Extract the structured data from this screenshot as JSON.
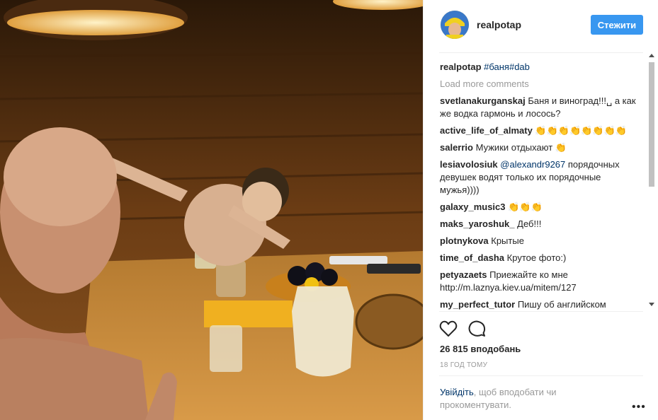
{
  "post": {
    "username": "realpotap",
    "follow_label": "Стежити",
    "caption_user": "realpotap",
    "caption_tags": "#баня#dab",
    "load_more": "Load more comments",
    "likes": "26 815 вподобань",
    "time": "18 ГОД ТОМУ",
    "login_link": "Увійдіть",
    "login_text": ", щоб вподобати чи прокоментувати.",
    "more": "•••"
  },
  "comments": [
    {
      "user": "svetlanakurganskaj",
      "text": "Баня и виноград!!!␣ а как же водка гармонь и лосось?"
    },
    {
      "user": "active_life_of_almaty",
      "text": "👏👏👏👏👏👏👏👏"
    },
    {
      "user": "salerrio",
      "text": "Мужики отдыхают 👏"
    },
    {
      "user": "lesiavolosiuk",
      "mention": "@alexandr9267",
      "text": " порядочных девушек водят только их порядочные мужья))))"
    },
    {
      "user": "galaxy_music3",
      "text": "👏👏👏"
    },
    {
      "user": "maks_yaroshuk_",
      "text": "Деб!!!"
    },
    {
      "user": "plotnykova",
      "text": "Крытые"
    },
    {
      "user": "time_of_dasha",
      "text": "Крутое фото:)"
    },
    {
      "user": "petyazaets",
      "text": "Приежайте ко мне http://m.laznya.kiev.ua/mitem/127"
    },
    {
      "user": "my_perfect_tutor",
      "text": "Пишу об английском"
    }
  ],
  "icons": {
    "heart": "heart-icon",
    "comment": "comment-icon",
    "more": "more-options-icon"
  },
  "colors": {
    "follow_button": "#3897f0",
    "link": "#003569",
    "muted": "#999999",
    "text": "#262626"
  }
}
